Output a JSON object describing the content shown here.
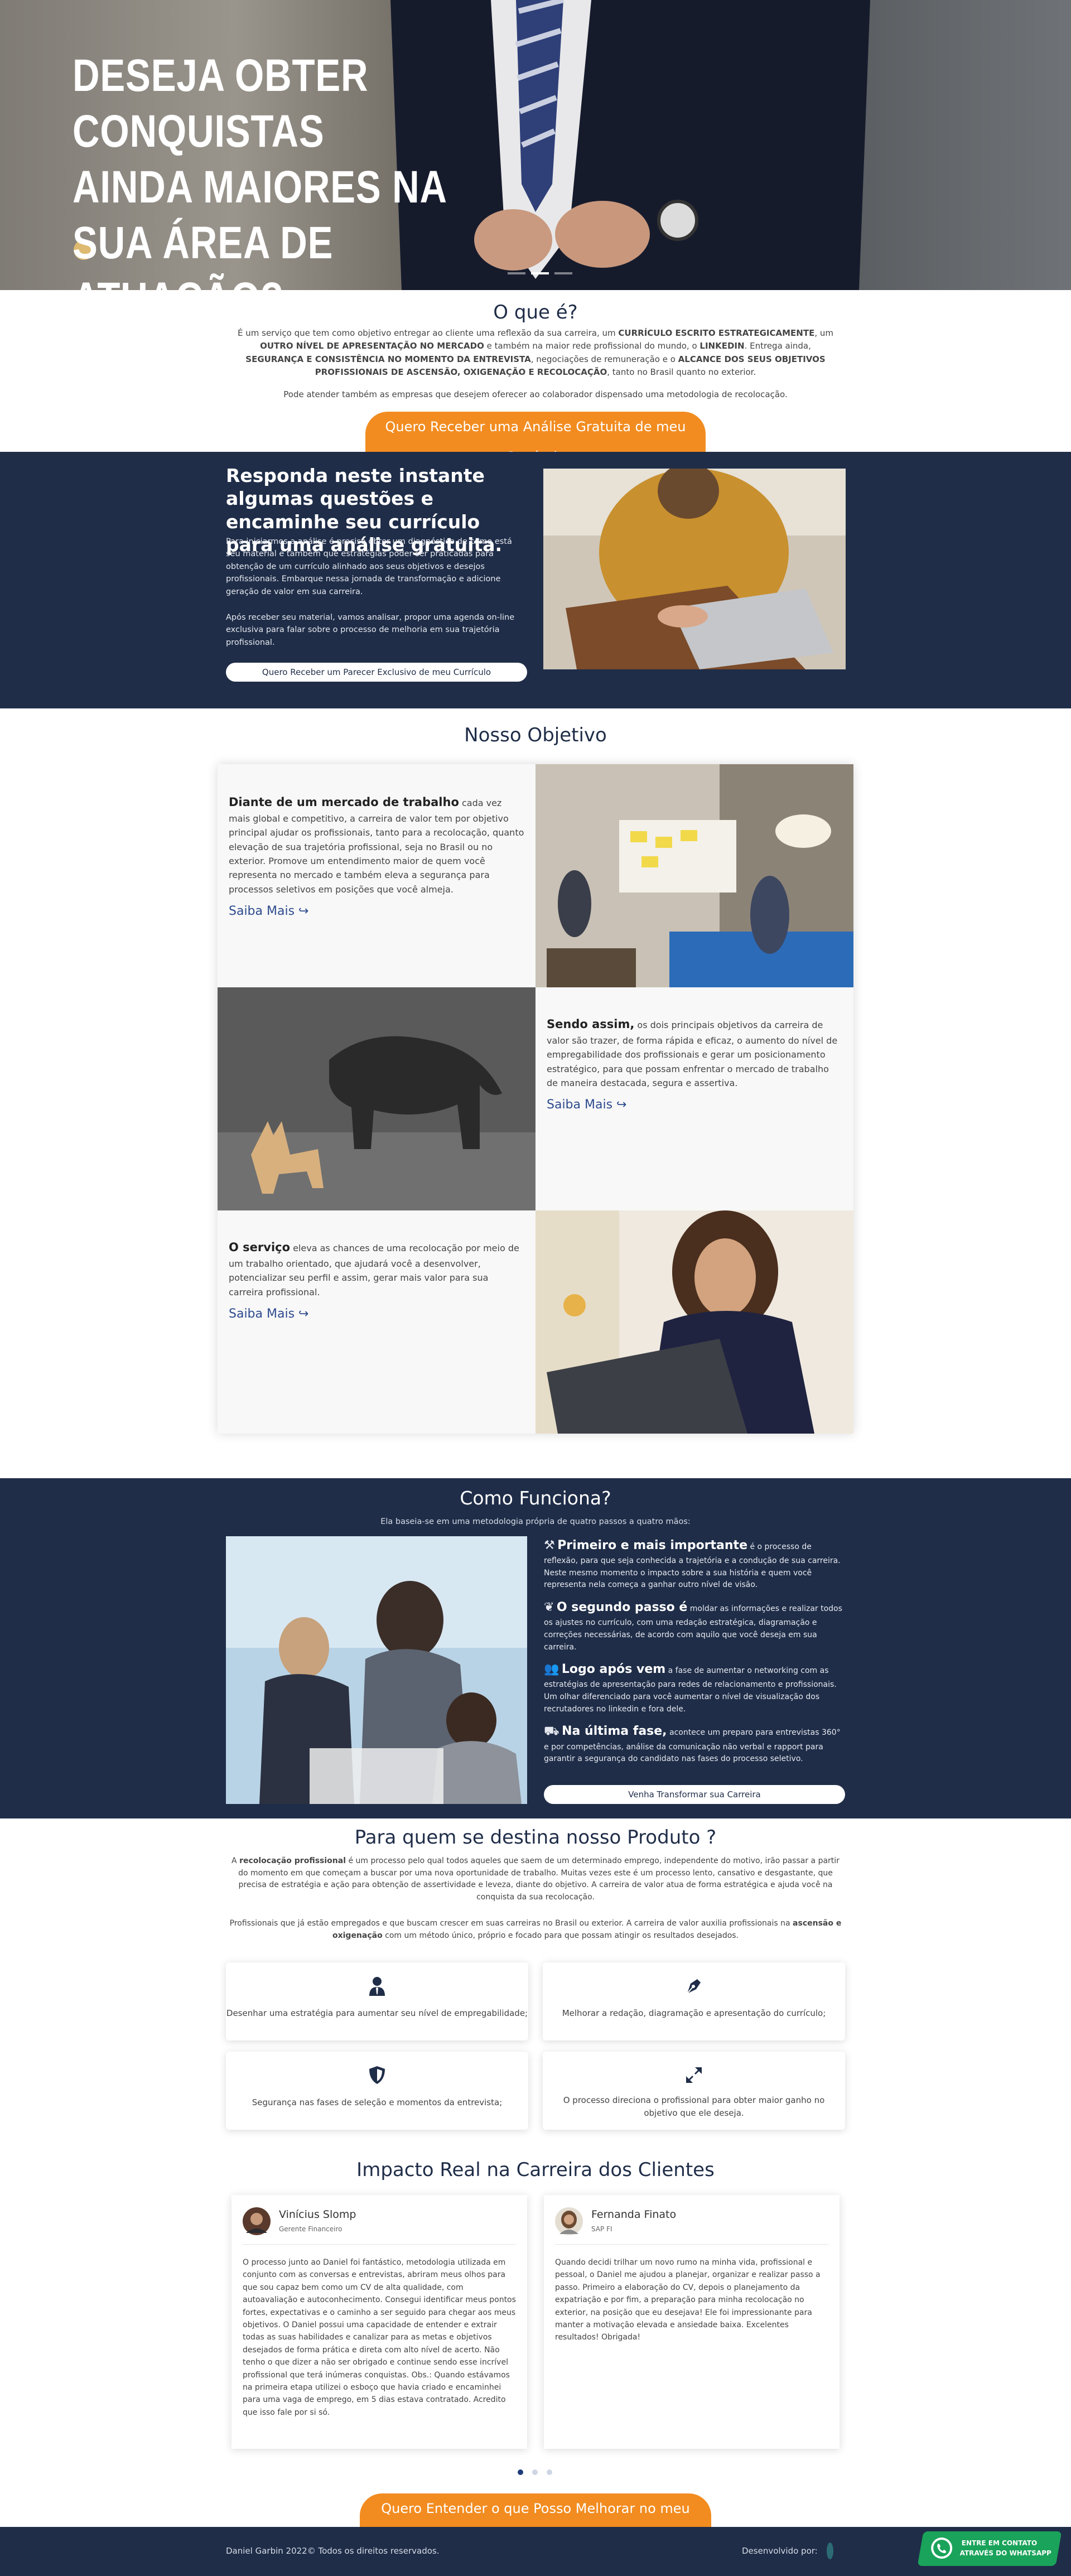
{
  "hero": {
    "title": "DESEJA OBTER CONQUISTAS AINDA MAIORES NA SUA ÁREA DE ATUAÇÃO?"
  },
  "what": {
    "title": "O que é?",
    "p1_a": "É um serviço que tem como objetivo entregar ao cliente uma reflexão da sua carreira, um ",
    "p1_b": "CURRÍCULO ESCRITO ESTRATEGICAMENTE",
    "p1_c": ", um ",
    "p1_d": "OUTRO NÍVEL DE APRESENTAÇÃO NO MERCADO",
    "p1_e": " e também na maior rede profissional do mundo, o ",
    "p1_f": "LINKEDIN",
    "p1_g": ". Entrega ainda, ",
    "p1_h": "SEGURANÇA E CONSISTÊNCIA NO MOMENTO DA ENTREVISTA",
    "p1_i": ", negociações de remuneração e o ",
    "p1_j": "ALCANCE DOS SEUS OBJETIVOS PROFISSIONAIS DE ASCENSÃO, OXIGENAÇÃO E RECOLOCAÇÃO",
    "p1_k": ", tanto no Brasil quanto no exterior.",
    "p2": "Pode atender também as empresas que desejem oferecer ao colaborador dispensado uma metodologia de recolocação.",
    "button": "Quero Receber uma Análise Gratuita de meu Currículo"
  },
  "respond": {
    "title": "Responda neste instante algumas questões e encaminhe seu currículo para uma análise gratuita.",
    "p1": "Para iniciarmos a análise é preciso obter um diagnóstico de como está seu material e também que estratégias poder ser praticadas para obtenção de um currículo alinhado aos seus objetivos e desejos profissionais. Embarque nessa jornada de transformação e adicione geração de valor em sua carreira.",
    "p2": "Após receber seu material, vamos analisar, propor uma agenda on-line exclusiva para falar sobre o processo de melhoria em sua trajetória profissional.",
    "button": "Quero Receber um Parecer Exclusivo de meu Currículo"
  },
  "objective": {
    "title": "Nosso Objetivo",
    "items": [
      {
        "lead": "Diante de um mercado de trabalho",
        "text": " cada vez mais global e competitivo, a carreira de valor tem por objetivo principal ajudar os profissionais, tanto para a recolocação, quanto elevação de sua trajetória profissional, seja no Brasil ou no exterior. Promove um entendimento maior de quem você representa no mercado e também eleva a segurança para processos seletivos em posições que você almeja.",
        "link": "Saiba Mais ↪"
      },
      {
        "lead": "Sendo assim,",
        "text": " os dois principais objetivos da carreira de valor são trazer, de forma rápida e eficaz, o aumento do nível de empregabilidade dos profissionais e gerar um posicionamento estratégico, para que possam enfrentar o mercado de trabalho de maneira destacada, segura e assertiva.",
        "link": "Saiba Mais ↪"
      },
      {
        "lead": "O serviço",
        "text": " eleva as chances de uma recolocação por meio de um trabalho orientado, que ajudará você a desenvolver, potencializar seu perfil e assim, gerar mais valor para sua carreira profissional.",
        "link": "Saiba Mais ↪"
      }
    ]
  },
  "how": {
    "title": "Como Funciona?",
    "subtitle": "Ela baseia-se em uma metodologia própria de quatro passos a quatro mãos:",
    "steps": [
      {
        "icon": "hammer-icon",
        "lead": "Primeiro e mais importante",
        "text": " é o processo de reflexão, para que seja conhecida a trajetória e a condução de sua carreira. Neste mesmo momento o impacto sobre a sua história e quem você representa nela começa a ganhar outro nível de visão."
      },
      {
        "icon": "leaf-icon",
        "lead": "O segundo passo é",
        "text": " moldar as informações e realizar todos os ajustes no currículo, com uma redação estratégica, diagramação e correções necessárias, de acordo com aquilo que você deseja em sua carreira."
      },
      {
        "icon": "users-icon",
        "lead": "Logo após vem",
        "text": " a fase de aumentar o networking com as estratégias de apresentação para redes de relacionamento e profissionais. Um olhar diferenciado para você aumentar o nível de visualização dos recrutadores no linkedin e fora dele."
      },
      {
        "icon": "truck-icon",
        "lead": "Na última fase,",
        "text": " acontece um preparo para entrevistas 360° e por competências, análise da comunicação não verbal e rapport para garantir a segurança do candidato nas fases do processo seletivo."
      }
    ],
    "button": "Venha Transformar sua Carreira"
  },
  "target": {
    "title": "Para quem se destina nosso Produto ?",
    "p1_a": "A ",
    "p1_b": "recolocação profissional",
    "p1_c": " é um processo pelo qual todos aqueles que saem de um determinado emprego, independente do motivo, irão passar a partir do momento em que começam a buscar por uma nova oportunidade de trabalho. Muitas vezes este é um processo lento, cansativo e desgastante, que precisa de estratégia e ação para obtenção de assertividade e leveza, diante do objetivo. A carreira de valor atua de forma estratégica e ajuda você na conquista da sua recolocação.",
    "p2_a": "Profissionais que já estão empregados e que buscam crescer em suas carreiras no Brasil ou exterior. A carreira de valor auxilia profissionais na ",
    "p2_b": "ascensão e oxigenação",
    "p2_c": " com um método único, próprio e focado para que possam atingir os resultados desejados.",
    "features": [
      {
        "icon": "user-tie-icon",
        "text": "Desenhar uma estratégia para aumentar seu nível de empregabilidade;"
      },
      {
        "icon": "pen-nib-icon",
        "text": "Melhorar a redação, diagramação e apresentação do currículo;"
      },
      {
        "icon": "shield-icon",
        "text": "Segurança nas fases de seleção e momentos da entrevista;"
      },
      {
        "icon": "expand-arrows-icon",
        "text": "O processo direciona o profissional para obter maior ganho no objetivo que ele deseja."
      }
    ]
  },
  "impact": {
    "title": "Impacto Real na Carreira dos Clientes",
    "testimonials": [
      {
        "name": "Vinícius Slomp",
        "role": "Gerente Financeiro",
        "text": "O processo junto ao Daniel foi fantástico, metodologia utilizada em conjunto com as conversas e entrevistas, abriram meus olhos para que sou capaz bem como um CV de alta qualidade, com autoavaliação e autoconhecimento. Consegui identificar meus pontos fortes, expectativas e o caminho a ser seguido para chegar aos meus objetivos. O Daniel possui uma capacidade de entender e extrair todas as suas habilidades e canalizar para as metas e objetivos desejados de forma prática e direta com alto nível de acerto. Não tenho o que dizer a não ser obrigado e continue sendo esse incrível profissional que terá inúmeras conquistas. Obs.: Quando estávamos na primeira etapa utilizei o esboço que havia criado e encaminhei para uma vaga de emprego, em 5 dias estava contratado. Acredito que isso fale por si só."
      },
      {
        "name": "Fernanda Finato",
        "role": "SAP FI",
        "text": "Quando decidi trilhar um novo rumo na minha vida, profissional e pessoal, o Daniel me ajudou a planejar, organizar e realizar passo a passo. Primeiro a elaboração do CV, depois o planejamento da expatriação e por fim, a preparação para minha recolocação no exterior, na posição que eu desejava! Ele foi impressionante para manter a motivação elevada e ansiedade baixa. Excelentes resultados! Obrigada!"
      }
    ],
    "button": "Quero Entender o que Posso Melhorar no meu Currículo"
  },
  "footer": {
    "copyright": "Daniel Garbin 2022© Todos os direitos reservados.",
    "dev_label": "Desenvolvido por:",
    "whatsapp_line1": "ENTRE EM CONTATO",
    "whatsapp_line2": "ATRAVÉS DO WHATSAPP"
  }
}
